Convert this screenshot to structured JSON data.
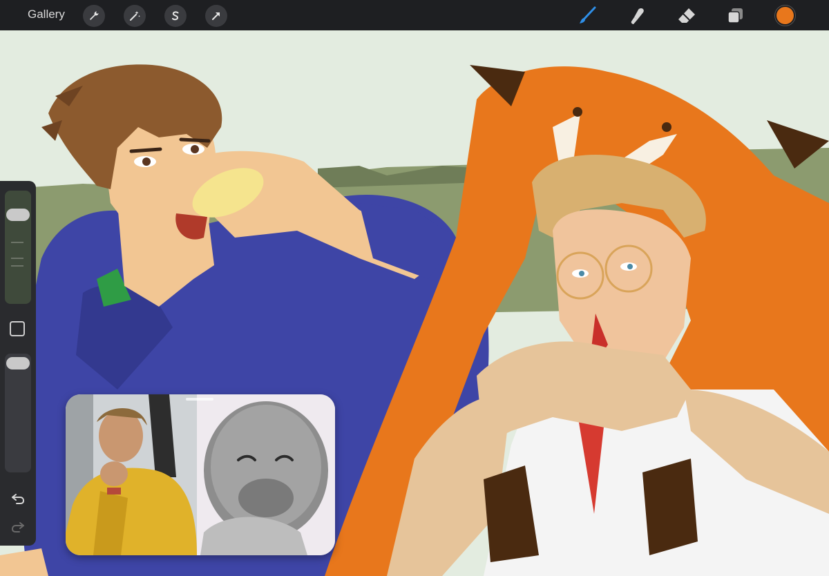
{
  "toolbar": {
    "gallery_label": "Gallery",
    "left_tools": [
      "wrench-icon",
      "magic-wand-icon",
      "selection-icon",
      "transform-arrow-icon"
    ],
    "right_tools": [
      "brush-icon",
      "smudge-icon",
      "eraser-icon",
      "layers-icon"
    ],
    "active_tool": "brush-icon",
    "active_tool_color": "#2f8fe8",
    "current_color": "#e8771c"
  },
  "sidebar": {
    "brush_size_level": 0.82,
    "opacity_level": 0.97,
    "buttons": [
      "modify-button",
      "undo-icon",
      "redo-icon"
    ]
  },
  "canvas": {
    "background_color": "#e3ece0",
    "horizon_color": "#8c9b6f",
    "hoodie_color": "#3e45a6",
    "fox_color": "#e8771c",
    "skin_color": "#f2c693"
  },
  "facetime_pip": {
    "present": true
  }
}
